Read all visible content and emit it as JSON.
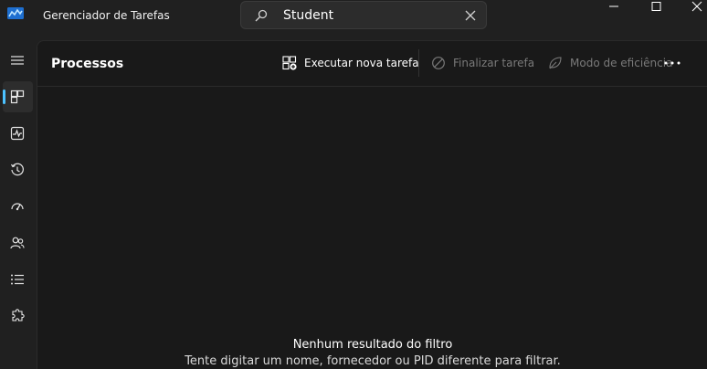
{
  "window": {
    "title": "Gerenciador de Tarefas"
  },
  "search": {
    "value": "Student"
  },
  "sidebar": {
    "items": [
      {
        "icon": "hamburger-menu-icon"
      },
      {
        "icon": "processes-icon",
        "active": true
      },
      {
        "icon": "performance-icon"
      },
      {
        "icon": "app-history-icon"
      },
      {
        "icon": "startup-apps-icon"
      },
      {
        "icon": "users-icon"
      },
      {
        "icon": "details-icon"
      },
      {
        "icon": "services-icon"
      }
    ]
  },
  "main": {
    "title": "Processos",
    "commands": {
      "run_new_task": "Executar nova tarefa",
      "end_task": "Finalizar tarefa",
      "efficiency_mode": "Modo de eficiência"
    },
    "empty_state": {
      "title": "Nenhum resultado do filtro",
      "message": "Tente digitar um nome, fornecedor ou PID diferente para filtrar."
    }
  },
  "colors": {
    "background": "#202020",
    "content": "#191919",
    "accent": "#4cc2ff",
    "disabled_text": "#7a7a7a"
  }
}
